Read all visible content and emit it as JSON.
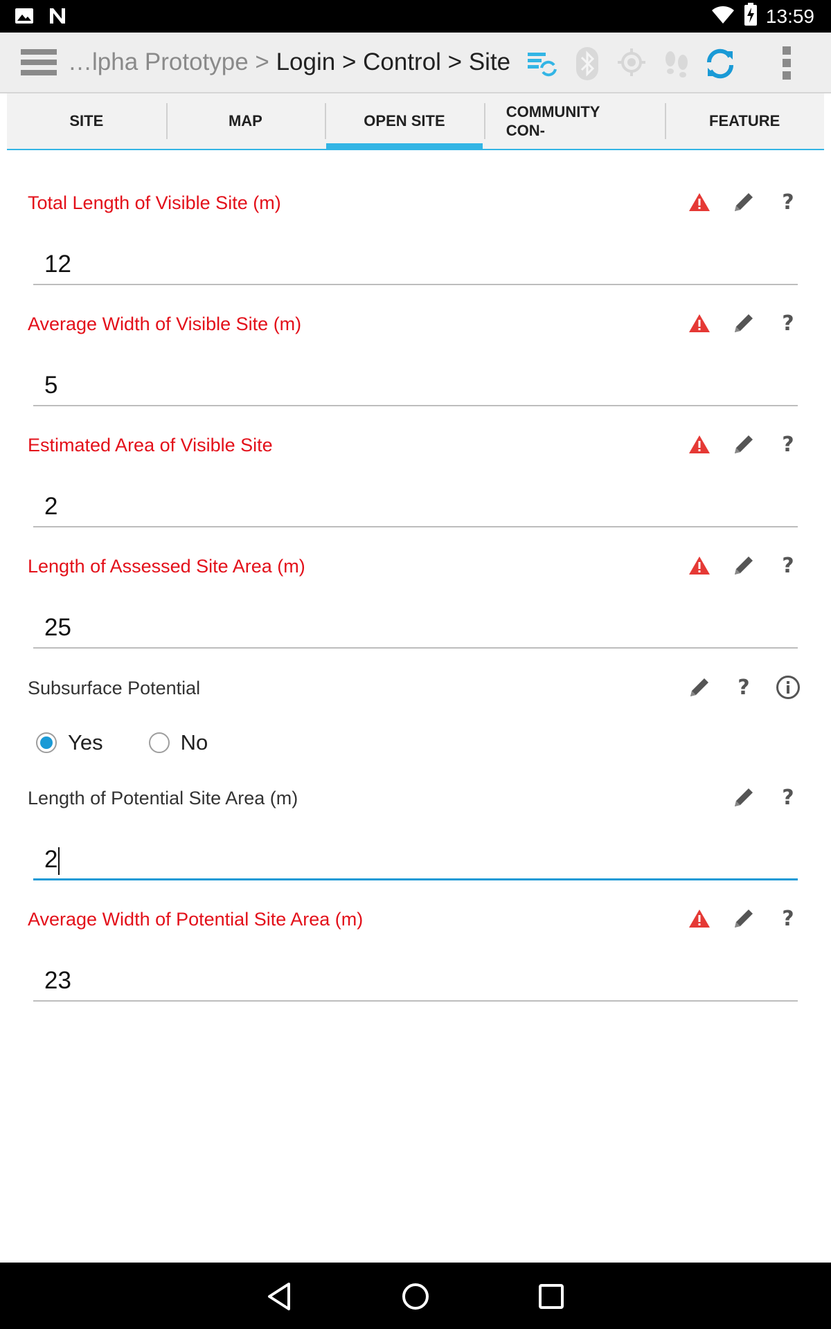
{
  "status_bar": {
    "time": "13:59",
    "icons": [
      "image-icon",
      "n-icon",
      "wifi-icon",
      "battery-charging-icon"
    ]
  },
  "action_bar": {
    "breadcrumb_dim": "…lpha Prototype > ",
    "breadcrumb_main": "Login > Control > Site",
    "icons": [
      "menu-icon",
      "sync-list-icon",
      "bluetooth-icon",
      "gps-icon",
      "footsteps-icon",
      "refresh-icon",
      "overflow-menu-icon"
    ],
    "accent_color": "#33b5e5"
  },
  "tabs": [
    {
      "label": "SITE"
    },
    {
      "label": "MAP"
    },
    {
      "label": "OPEN SITE"
    },
    {
      "label_line1": "COMMUNITY",
      "label_line2": "CON-"
    },
    {
      "label": "FEATURE"
    }
  ],
  "fields": [
    {
      "label": "Total Length of Visible Site (m)",
      "value": "12",
      "error": true
    },
    {
      "label": "Average Width of Visible Site (m)",
      "value": "5",
      "error": true
    },
    {
      "label": "Estimated Area of Visible Site",
      "value": "2",
      "error": true
    },
    {
      "label": "Length of Assessed Site Area (m)",
      "value": "25",
      "error": true
    },
    {
      "label": "Subsurface Potential",
      "options": [
        "Yes",
        "No"
      ],
      "selected": "Yes",
      "error": false
    },
    {
      "label": "Length of Potential Site Area (m)",
      "value": "2",
      "error": false,
      "focused": true
    },
    {
      "label": "Average Width of Potential Site Area (m)",
      "value": "23",
      "error": true
    }
  ],
  "help_glyph": "?",
  "colors": {
    "error_text": "#e3101a",
    "warning_icon": "#e53935",
    "focus_underline": "#1a9ad6",
    "radio_selected": "#1a9ad6"
  },
  "nav_bar": {
    "icons": [
      "back-icon",
      "home-icon",
      "recents-icon"
    ]
  }
}
